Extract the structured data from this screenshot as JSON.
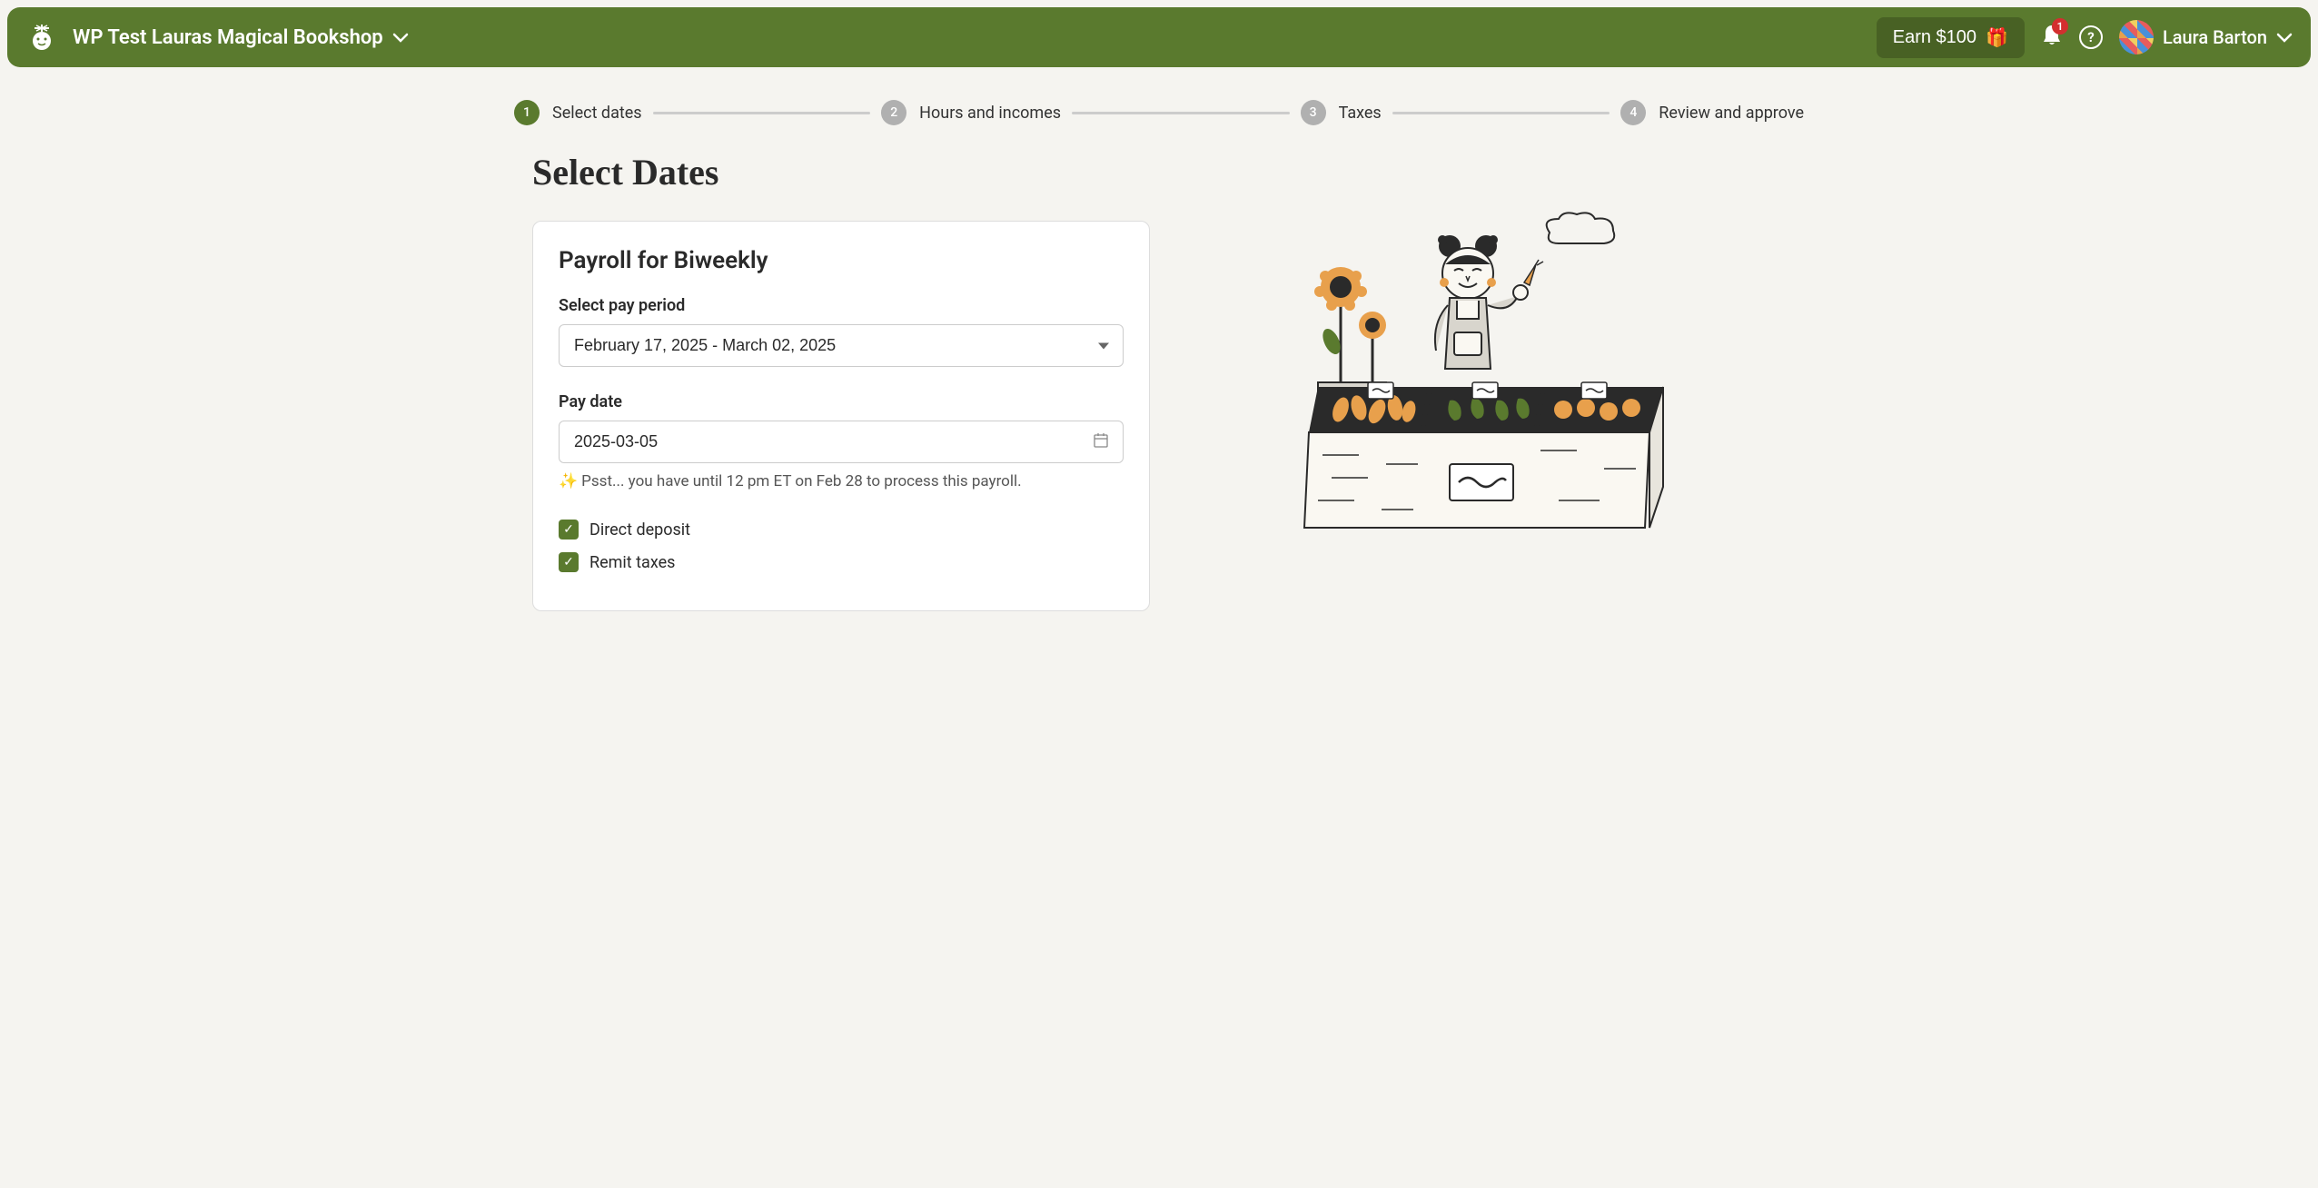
{
  "header": {
    "store_name": "WP Test Lauras Magical Bookshop",
    "earn_label": "Earn $100",
    "notification_count": "1",
    "user_name": "Laura Barton"
  },
  "stepper": {
    "steps": [
      {
        "num": "1",
        "label": "Select dates",
        "active": true
      },
      {
        "num": "2",
        "label": "Hours and incomes",
        "active": false
      },
      {
        "num": "3",
        "label": "Taxes",
        "active": false
      },
      {
        "num": "4",
        "label": "Review and approve",
        "active": false
      }
    ]
  },
  "page": {
    "title": "Select Dates"
  },
  "card": {
    "title": "Payroll for Biweekly",
    "pay_period_label": "Select pay period",
    "pay_period_value": "February 17, 2025 - March 02, 2025",
    "pay_date_label": "Pay date",
    "pay_date_value": "2025-03-05",
    "hint_text": "Psst... you have until 12 pm ET on Feb 28 to process this payroll.",
    "direct_deposit_label": "Direct deposit",
    "remit_taxes_label": "Remit taxes"
  }
}
